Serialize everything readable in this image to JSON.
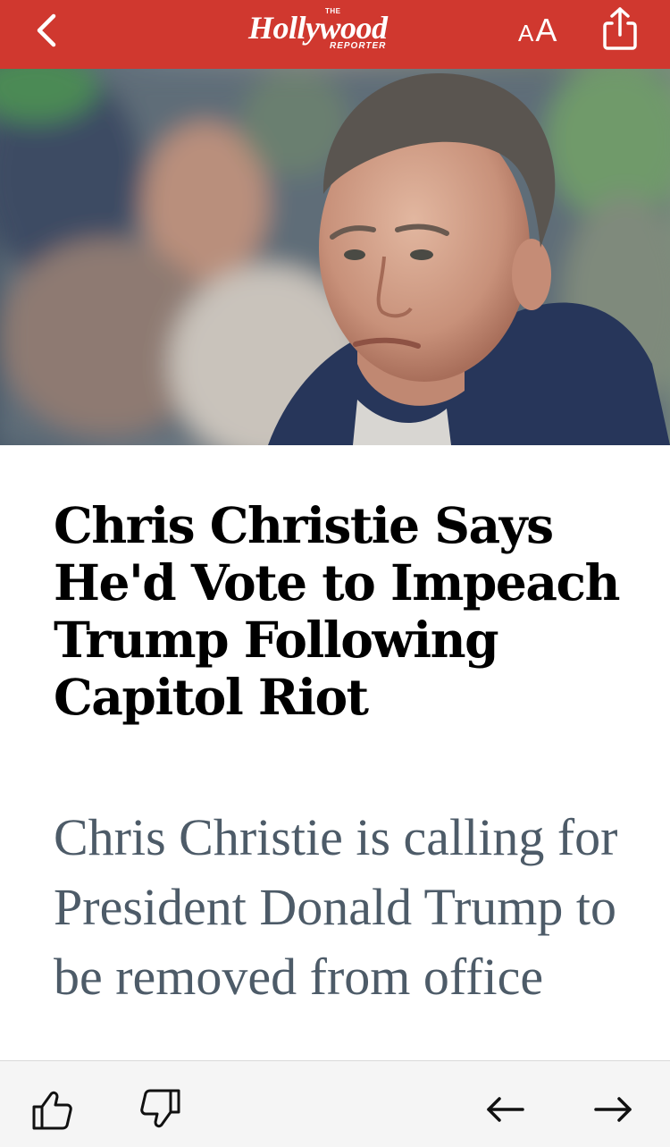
{
  "header": {
    "logo": {
      "the": "THE",
      "main": "Hollywood",
      "sub": "REPORTER"
    },
    "text_size": {
      "small": "A",
      "large": "A"
    },
    "background_color": "#d0382f",
    "icons": {
      "back": "chevron-left-icon",
      "share": "share-icon"
    }
  },
  "article": {
    "headline": "Chris Christie Says He'd Vote to Impeach Trump Following Capitol Riot",
    "dek": "Chris Christie is calling for President Donald Trump to be removed from office"
  },
  "toolbar": {
    "icons": [
      "thumbs-up-icon",
      "thumbs-down-icon",
      "arrow-left-icon",
      "arrow-right-icon"
    ]
  }
}
